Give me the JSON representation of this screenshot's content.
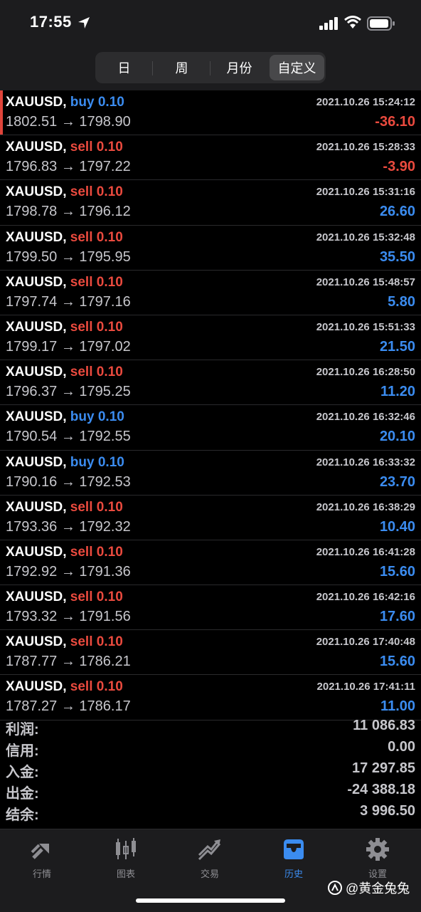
{
  "status_bar": {
    "time": "17:55"
  },
  "period_tabs": [
    {
      "label": "日"
    },
    {
      "label": "周"
    },
    {
      "label": "月份"
    },
    {
      "label": "自定义",
      "active": true
    }
  ],
  "trades": [
    {
      "symbol": "XAUUSD,",
      "side": "buy",
      "volume": "0.10",
      "open_close": "1802.51 → 1798.90",
      "time": "2021.10.26 15:24:12",
      "profit": "-36.10"
    },
    {
      "symbol": "XAUUSD,",
      "side": "sell",
      "volume": "0.10",
      "open_close": "1796.83 → 1797.22",
      "time": "2021.10.26 15:28:33",
      "profit": "-3.90"
    },
    {
      "symbol": "XAUUSD,",
      "side": "sell",
      "volume": "0.10",
      "open_close": "1798.78 → 1796.12",
      "time": "2021.10.26 15:31:16",
      "profit": "26.60"
    },
    {
      "symbol": "XAUUSD,",
      "side": "sell",
      "volume": "0.10",
      "open_close": "1799.50 → 1795.95",
      "time": "2021.10.26 15:32:48",
      "profit": "35.50"
    },
    {
      "symbol": "XAUUSD,",
      "side": "sell",
      "volume": "0.10",
      "open_close": "1797.74 → 1797.16",
      "time": "2021.10.26 15:48:57",
      "profit": "5.80"
    },
    {
      "symbol": "XAUUSD,",
      "side": "sell",
      "volume": "0.10",
      "open_close": "1799.17 → 1797.02",
      "time": "2021.10.26 15:51:33",
      "profit": "21.50"
    },
    {
      "symbol": "XAUUSD,",
      "side": "sell",
      "volume": "0.10",
      "open_close": "1796.37 → 1795.25",
      "time": "2021.10.26 16:28:50",
      "profit": "11.20"
    },
    {
      "symbol": "XAUUSD,",
      "side": "buy",
      "volume": "0.10",
      "open_close": "1790.54 → 1792.55",
      "time": "2021.10.26 16:32:46",
      "profit": "20.10"
    },
    {
      "symbol": "XAUUSD,",
      "side": "buy",
      "volume": "0.10",
      "open_close": "1790.16 → 1792.53",
      "time": "2021.10.26 16:33:32",
      "profit": "23.70"
    },
    {
      "symbol": "XAUUSD,",
      "side": "sell",
      "volume": "0.10",
      "open_close": "1793.36 → 1792.32",
      "time": "2021.10.26 16:38:29",
      "profit": "10.40"
    },
    {
      "symbol": "XAUUSD,",
      "side": "sell",
      "volume": "0.10",
      "open_close": "1792.92 → 1791.36",
      "time": "2021.10.26 16:41:28",
      "profit": "15.60"
    },
    {
      "symbol": "XAUUSD,",
      "side": "sell",
      "volume": "0.10",
      "open_close": "1793.32 → 1791.56",
      "time": "2021.10.26 16:42:16",
      "profit": "17.60"
    },
    {
      "symbol": "XAUUSD,",
      "side": "sell",
      "volume": "0.10",
      "open_close": "1787.77 → 1786.21",
      "time": "2021.10.26 17:40:48",
      "profit": "15.60"
    },
    {
      "symbol": "XAUUSD,",
      "side": "sell",
      "volume": "0.10",
      "open_close": "1787.27 → 1786.17",
      "time": "2021.10.26 17:41:11",
      "profit": "11.00"
    }
  ],
  "summary": [
    {
      "label": "利润:",
      "value": "11 086.83"
    },
    {
      "label": "信用:",
      "value": "0.00"
    },
    {
      "label": "入金:",
      "value": "17 297.85"
    },
    {
      "label": "出金:",
      "value": "-24 388.18"
    },
    {
      "label": "结余:",
      "value": "3 996.50"
    }
  ],
  "tab_bar": [
    {
      "label": "行情",
      "icon": "quotes-icon"
    },
    {
      "label": "图表",
      "icon": "chart-icon"
    },
    {
      "label": "交易",
      "icon": "trade-icon"
    },
    {
      "label": "历史",
      "icon": "history-icon",
      "active": true
    },
    {
      "label": "设置",
      "icon": "settings-icon"
    }
  ],
  "watermark": "@黄金兔兔",
  "colors": {
    "buy": "#3b8cf0",
    "sell": "#ea4a3e",
    "accent": "#3b8cf0",
    "background": "#000000"
  }
}
